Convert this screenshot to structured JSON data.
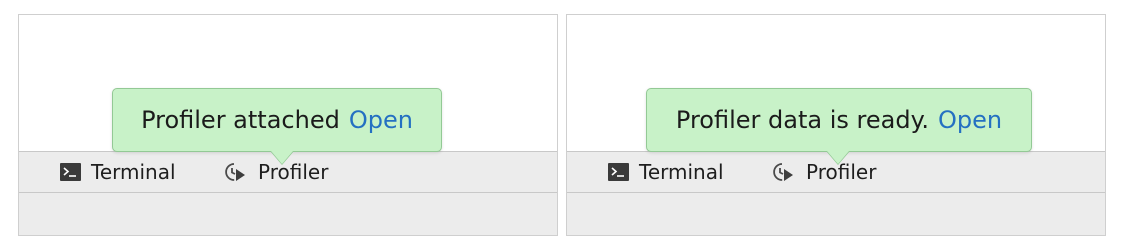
{
  "panels": [
    {
      "balloon": {
        "message": "Profiler attached",
        "link": "Open"
      },
      "toolbar": {
        "terminal": "Terminal",
        "profiler": "Profiler"
      }
    },
    {
      "balloon": {
        "message": "Profiler data is ready.",
        "link": "Open"
      },
      "toolbar": {
        "terminal": "Terminal",
        "profiler": "Profiler"
      }
    }
  ],
  "icons": {
    "terminal": "terminal-icon",
    "profiler": "profiler-icon"
  },
  "colors": {
    "balloon_bg": "#c8f2c8",
    "balloon_border": "#93c995",
    "link": "#2470c2",
    "toolbar_bg": "#ececec"
  }
}
